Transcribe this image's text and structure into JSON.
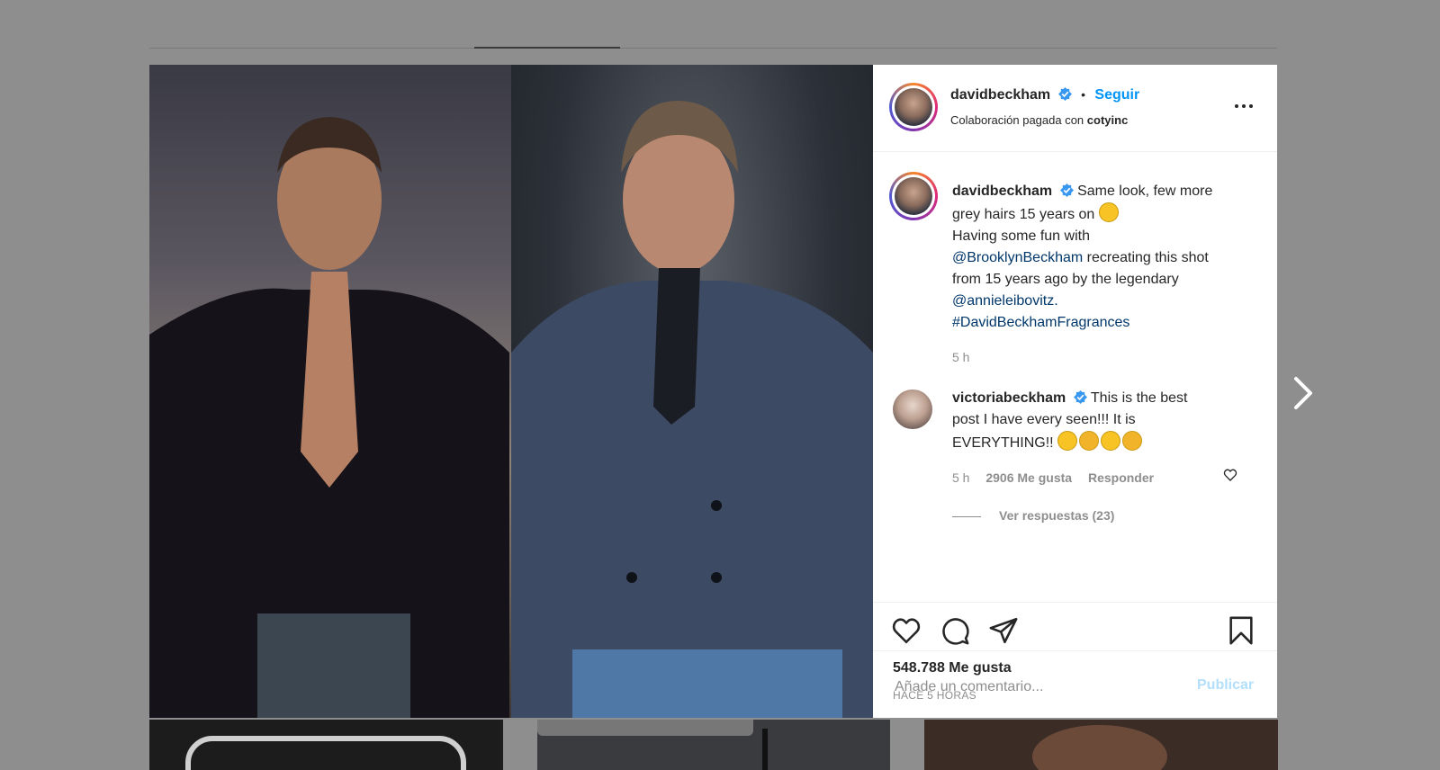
{
  "post": {
    "author": "davidbeckham",
    "follow_label": "Seguir",
    "separator": "•",
    "paid_prefix": "Colaboración pagada con",
    "paid_partner": "cotyinc",
    "caption": {
      "author": "davidbeckham",
      "text_1": "Same look, few more grey hairs 15 years on",
      "text_2": "Having some fun with",
      "mention_1": "@BrooklynBeckham",
      "text_3": "recreating this shot from 15 years ago by the legendary",
      "mention_2": "@annieleibovitz.",
      "hashtag": "#DavidBeckhamFragrances",
      "time": "5 h"
    },
    "comment": {
      "author": "victoriabeckham",
      "text": "This is the best post I have every seen!!! It is EVERYTHING!!",
      "time": "5 h",
      "likes": "2906 Me gusta",
      "reply_label": "Responder",
      "view_replies": "Ver respuestas (23)"
    },
    "likes_count": "548.788 Me gusta",
    "timestamp": "HACE 5 HORAS",
    "comment_placeholder": "Añade un comentario...",
    "publish_label": "Publicar"
  },
  "icons": {
    "verified": "verified-badge-icon",
    "more": "more-options-icon",
    "like": "heart-icon",
    "comment": "comment-icon",
    "share": "send-icon",
    "save": "bookmark-icon",
    "next": "chevron-right-icon"
  },
  "colors": {
    "accent": "#0095f6",
    "link": "#00376b",
    "muted": "#8e8e8e",
    "publish_disabled": "#b2dffc"
  }
}
